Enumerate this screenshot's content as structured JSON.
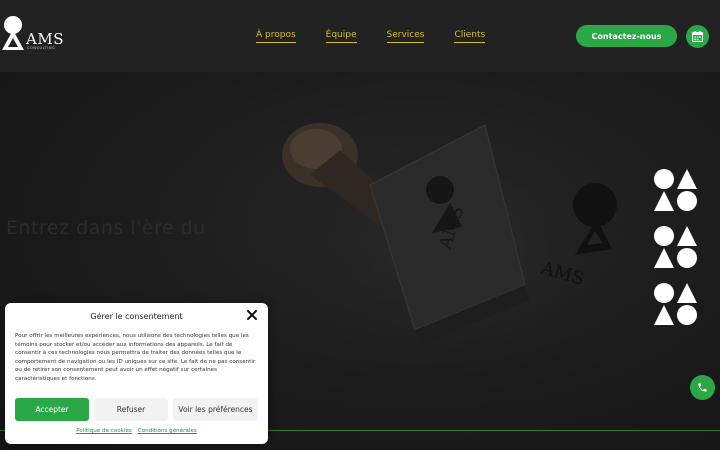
{
  "brand": {
    "name": "AMS",
    "tagline": "CONSULTING"
  },
  "nav": {
    "items": [
      "À propos",
      "Équipe",
      "Services",
      "Clients"
    ]
  },
  "header": {
    "contact_label": "Contactez-nous"
  },
  "hero": {
    "ghost_text": "Entrez dans l'ère du"
  },
  "consent": {
    "title": "Gérer le consentement",
    "body": "Pour offrir les meilleures expériences, nous utilisons des technologies telles que les témoins pour stocker et/ou accéder aux informations des appareils. Le fait de consentir à ces technologies nous permettra de traiter des données telles que le comportement de navigation ou les ID uniques sur ce site. Le fait de ne pas consentir ou de retirer son consentement peut avoir un effet négatif sur certaines caractéristiques et fonctions.",
    "accept_label": "Accepter",
    "refuse_label": "Refuser",
    "prefs_label": "Voir les préférences",
    "link_cookies": "Politique de cookies",
    "link_terms": "Conditions générales"
  },
  "colors": {
    "accent": "#2aa845",
    "nav_link": "#d6bf2a",
    "background": "#1d1d1d"
  },
  "icons": {
    "calendar": "calendar-icon",
    "phone": "phone-icon",
    "close": "close-icon"
  }
}
